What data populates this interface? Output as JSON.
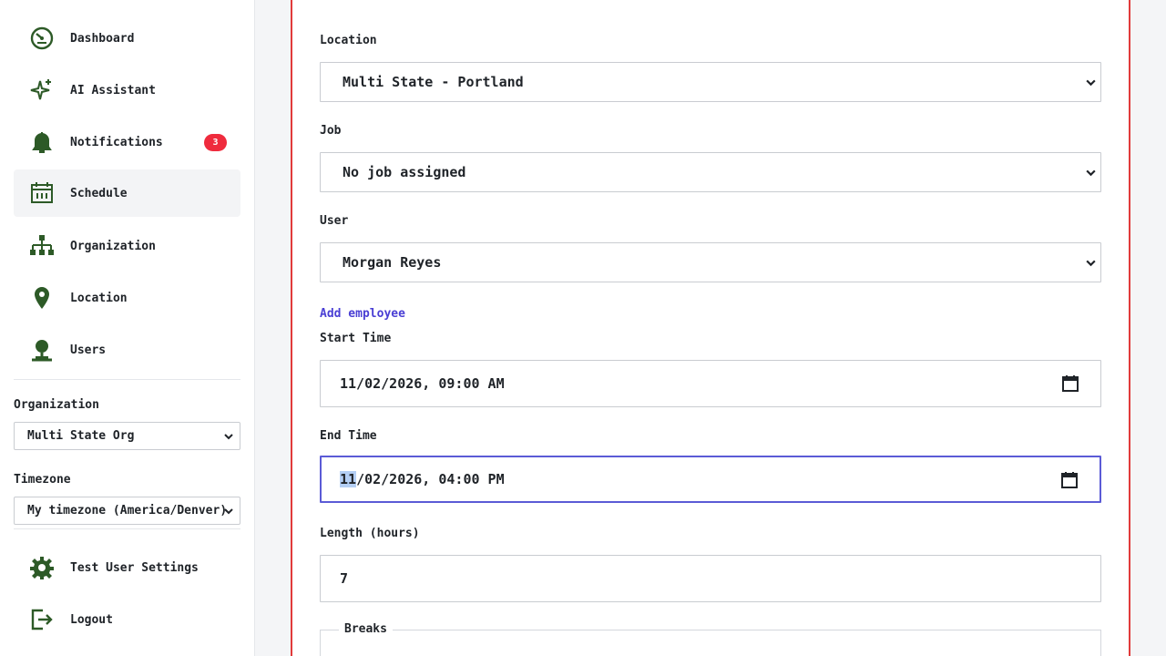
{
  "sidebar": {
    "nav": [
      {
        "label": "Dashboard",
        "icon": "dashboard-icon"
      },
      {
        "label": "AI Assistant",
        "icon": "sparkle-icon"
      },
      {
        "label": "Notifications",
        "icon": "bell-icon",
        "badge": "3"
      },
      {
        "label": "Schedule",
        "icon": "calendar-icon",
        "active": true
      },
      {
        "label": "Organization",
        "icon": "org-chart-icon"
      },
      {
        "label": "Location",
        "icon": "location-pin-icon"
      },
      {
        "label": "Users",
        "icon": "user-icon"
      }
    ],
    "organization": {
      "label": "Organization",
      "value": "Multi State Org"
    },
    "timezone": {
      "label": "Timezone",
      "value": "My timezone (America/Denver)"
    },
    "bottom": [
      {
        "label": "Test User Settings",
        "icon": "gear-icon"
      },
      {
        "label": "Logout",
        "icon": "logout-icon"
      }
    ]
  },
  "form": {
    "location": {
      "label": "Location",
      "value": "Multi State - Portland"
    },
    "job": {
      "label": "Job",
      "value": "No job assigned"
    },
    "user": {
      "label": "User",
      "value": "Morgan Reyes"
    },
    "add_employee": "Add employee",
    "start_time": {
      "label": "Start Time",
      "value": "11/02/2026, 09:00 AM"
    },
    "end_time": {
      "label": "End Time",
      "month": "11",
      "rest": "/02/2026, 04:00 PM"
    },
    "length": {
      "label": "Length (hours)",
      "value": "7"
    },
    "breaks": {
      "label": "Breaks"
    }
  },
  "colors": {
    "icon_green": "#2d5a27",
    "badge_red": "#ef2b3d",
    "card_border": "#e13b3b",
    "focus_ring": "#5b5bd6",
    "link": "#4a3fd4"
  }
}
